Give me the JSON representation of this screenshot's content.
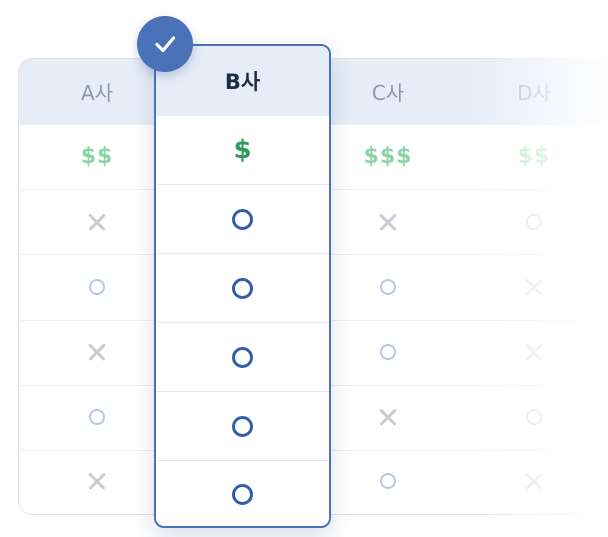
{
  "columns": [
    {
      "label": "A사",
      "price": "$$",
      "features": [
        "x",
        "o",
        "x",
        "o",
        "x"
      ]
    },
    {
      "label": "B사",
      "price": "$",
      "features": [
        "o",
        "o",
        "o",
        "o",
        "o"
      ],
      "selected": true
    },
    {
      "label": "C사",
      "price": "$$$",
      "features": [
        "x",
        "o",
        "o",
        "x",
        "o"
      ]
    },
    {
      "label": "D사",
      "price": "$$",
      "features": [
        "o",
        "x",
        "x",
        "o",
        "x"
      ]
    }
  ],
  "colors": {
    "accent": "#4a72b8",
    "header_bg": "#e6edf7",
    "price_green": "#2e9a5c",
    "price_green_muted": "#8bd4a7",
    "o_mark": "#2f5faa",
    "o_mark_muted": "#b7c8e2",
    "x_mark": "#c8ccd3"
  },
  "icons": {
    "selected_badge": "checkmark-icon",
    "included": "circle-icon",
    "excluded": "cross-icon"
  }
}
